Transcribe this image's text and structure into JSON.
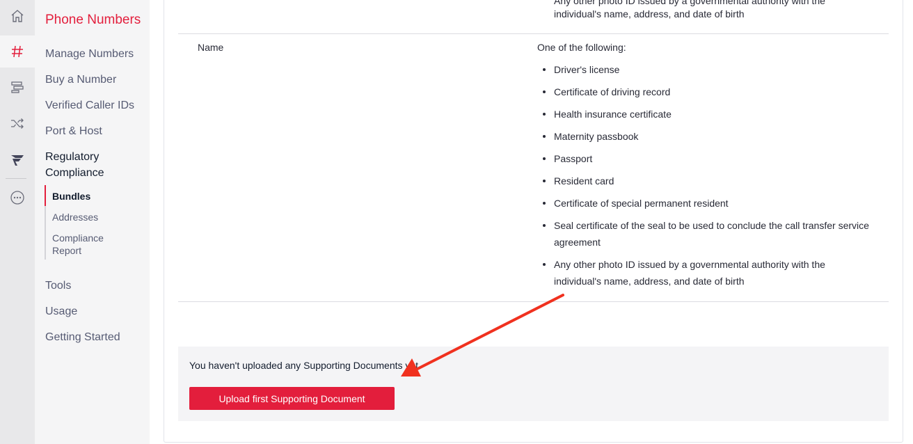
{
  "rail": {
    "icons": [
      "home-icon",
      "hash-icon",
      "filter-icon",
      "shuffle-icon",
      "studio-icon",
      "more-icon"
    ]
  },
  "nav": {
    "title": "Phone Numbers",
    "items": [
      "Manage Numbers",
      "Buy a Number",
      "Verified Caller IDs",
      "Port & Host"
    ],
    "section": "Regulatory Compliance",
    "sub_items": [
      "Bundles",
      "Addresses",
      "Compliance Report"
    ],
    "bottom_items": [
      "Tools",
      "Usage",
      "Getting Started"
    ]
  },
  "prev_row": {
    "line1": "Any other photo ID issued by a governmental authority with the",
    "line2": "individual's name, address, and date of birth"
  },
  "name_row": {
    "label": "Name",
    "intro": "One of the following:",
    "documents": [
      "Driver's license",
      "Certificate of driving record",
      "Health insurance certificate",
      "Maternity passbook",
      "Passport",
      "Resident card",
      "Certificate of special permanent resident",
      "Seal certificate of the seal to be used to conclude the call transfer service agreement",
      "Any other photo ID issued by a governmental authority with the individual's name, address, and date of birth"
    ]
  },
  "callout": {
    "message": "You haven't uploaded any Supporting Documents yet.",
    "button": "Upload first Supporting Document"
  },
  "colors": {
    "accent": "#e31e3c",
    "annotation_arrow": "#f0311f"
  }
}
